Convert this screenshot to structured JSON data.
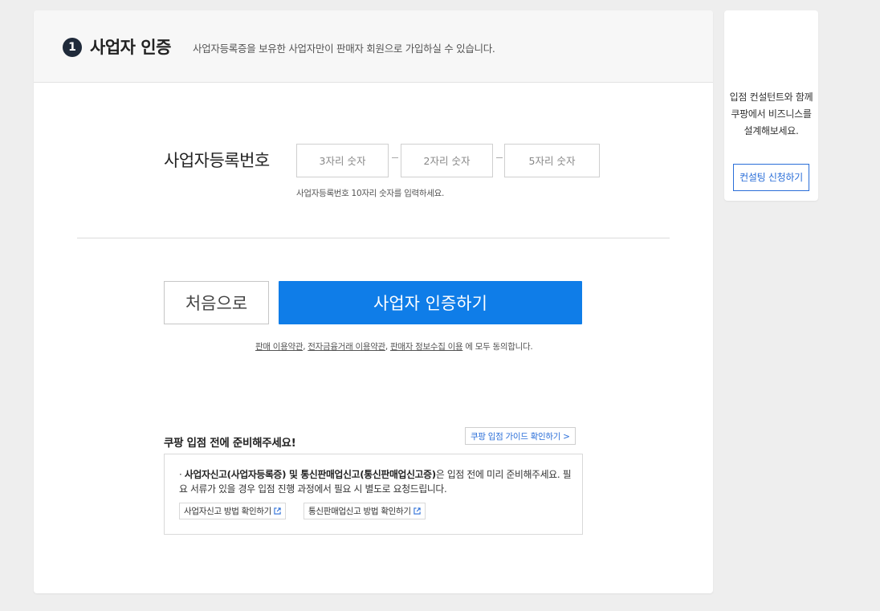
{
  "header": {
    "step_number": "1",
    "title": "사업자 인증",
    "description": "사업자등록증을 보유한 사업자만이 판매자 회원으로 가입하실 수 있습니다."
  },
  "registration": {
    "label": "사업자등록번호",
    "field1_placeholder": "3자리 숫자",
    "field2_placeholder": "2자리 숫자",
    "field3_placeholder": "5자리 숫자",
    "hint": "사업자등록번호 10자리 숫자를 입력하세요."
  },
  "actions": {
    "back_label": "처음으로",
    "auth_label": "사업자 인증하기"
  },
  "terms": {
    "link1": "판매 이용약관",
    "sep1": ", ",
    "link2": "전자금융거래 이용약관",
    "sep2": ", ",
    "link3": "판매자 정보수집 이용",
    "suffix": " 에 모두 동의합니다."
  },
  "prep": {
    "title": "쿠팡 입점 전에 준비해주세요!",
    "guide_label": "쿠팡 입점 가이드 확인하기 >",
    "bullet": "· ",
    "bold_text": "사업자신고(사업자등록증) 및 통신판매업신고(통신판매업신고증)",
    "text": "은 입점 전에 미리 준비해주세요. 필요 서류가 있을 경우 입점 진행 과정에서 필요 시 별도로 요청드립니다.",
    "link1_label": "사업자신고 방법 확인하기",
    "link2_label": "통신판매업신고 방법 확인하기"
  },
  "sidebar": {
    "text": "입점 컨설턴트와 함께 쿠팡에서 비즈니스를 설계해보세요.",
    "button_label": "컨설팅 신청하기"
  },
  "colors": {
    "primary": "#0f7de8",
    "link_blue": "#2a6ed8",
    "badge": "#1f2a3a"
  }
}
